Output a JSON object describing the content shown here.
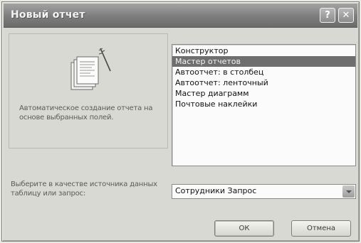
{
  "window": {
    "title": "Новый отчет",
    "help_glyph": "?",
    "close_glyph": "✕"
  },
  "description": "Автоматическое создание отчета на основе выбранных полей.",
  "report_types": [
    {
      "label": "Конструктор",
      "selected": false
    },
    {
      "label": "Мастер отчетов",
      "selected": true
    },
    {
      "label": "Автоотчет: в столбец",
      "selected": false
    },
    {
      "label": "Автоотчет: ленточный",
      "selected": false
    },
    {
      "label": "Мастер диаграмм",
      "selected": false
    },
    {
      "label": "Почтовые наклейки",
      "selected": false
    }
  ],
  "source": {
    "label": "Выберите в качестве источника данных таблицу или запрос:",
    "value": "Сотрудники Запрос"
  },
  "buttons": {
    "ok": "ОК",
    "cancel": "Отмена"
  },
  "colors": {
    "selection": "#6e6e6e",
    "titlebar": "#8a8a8a"
  }
}
